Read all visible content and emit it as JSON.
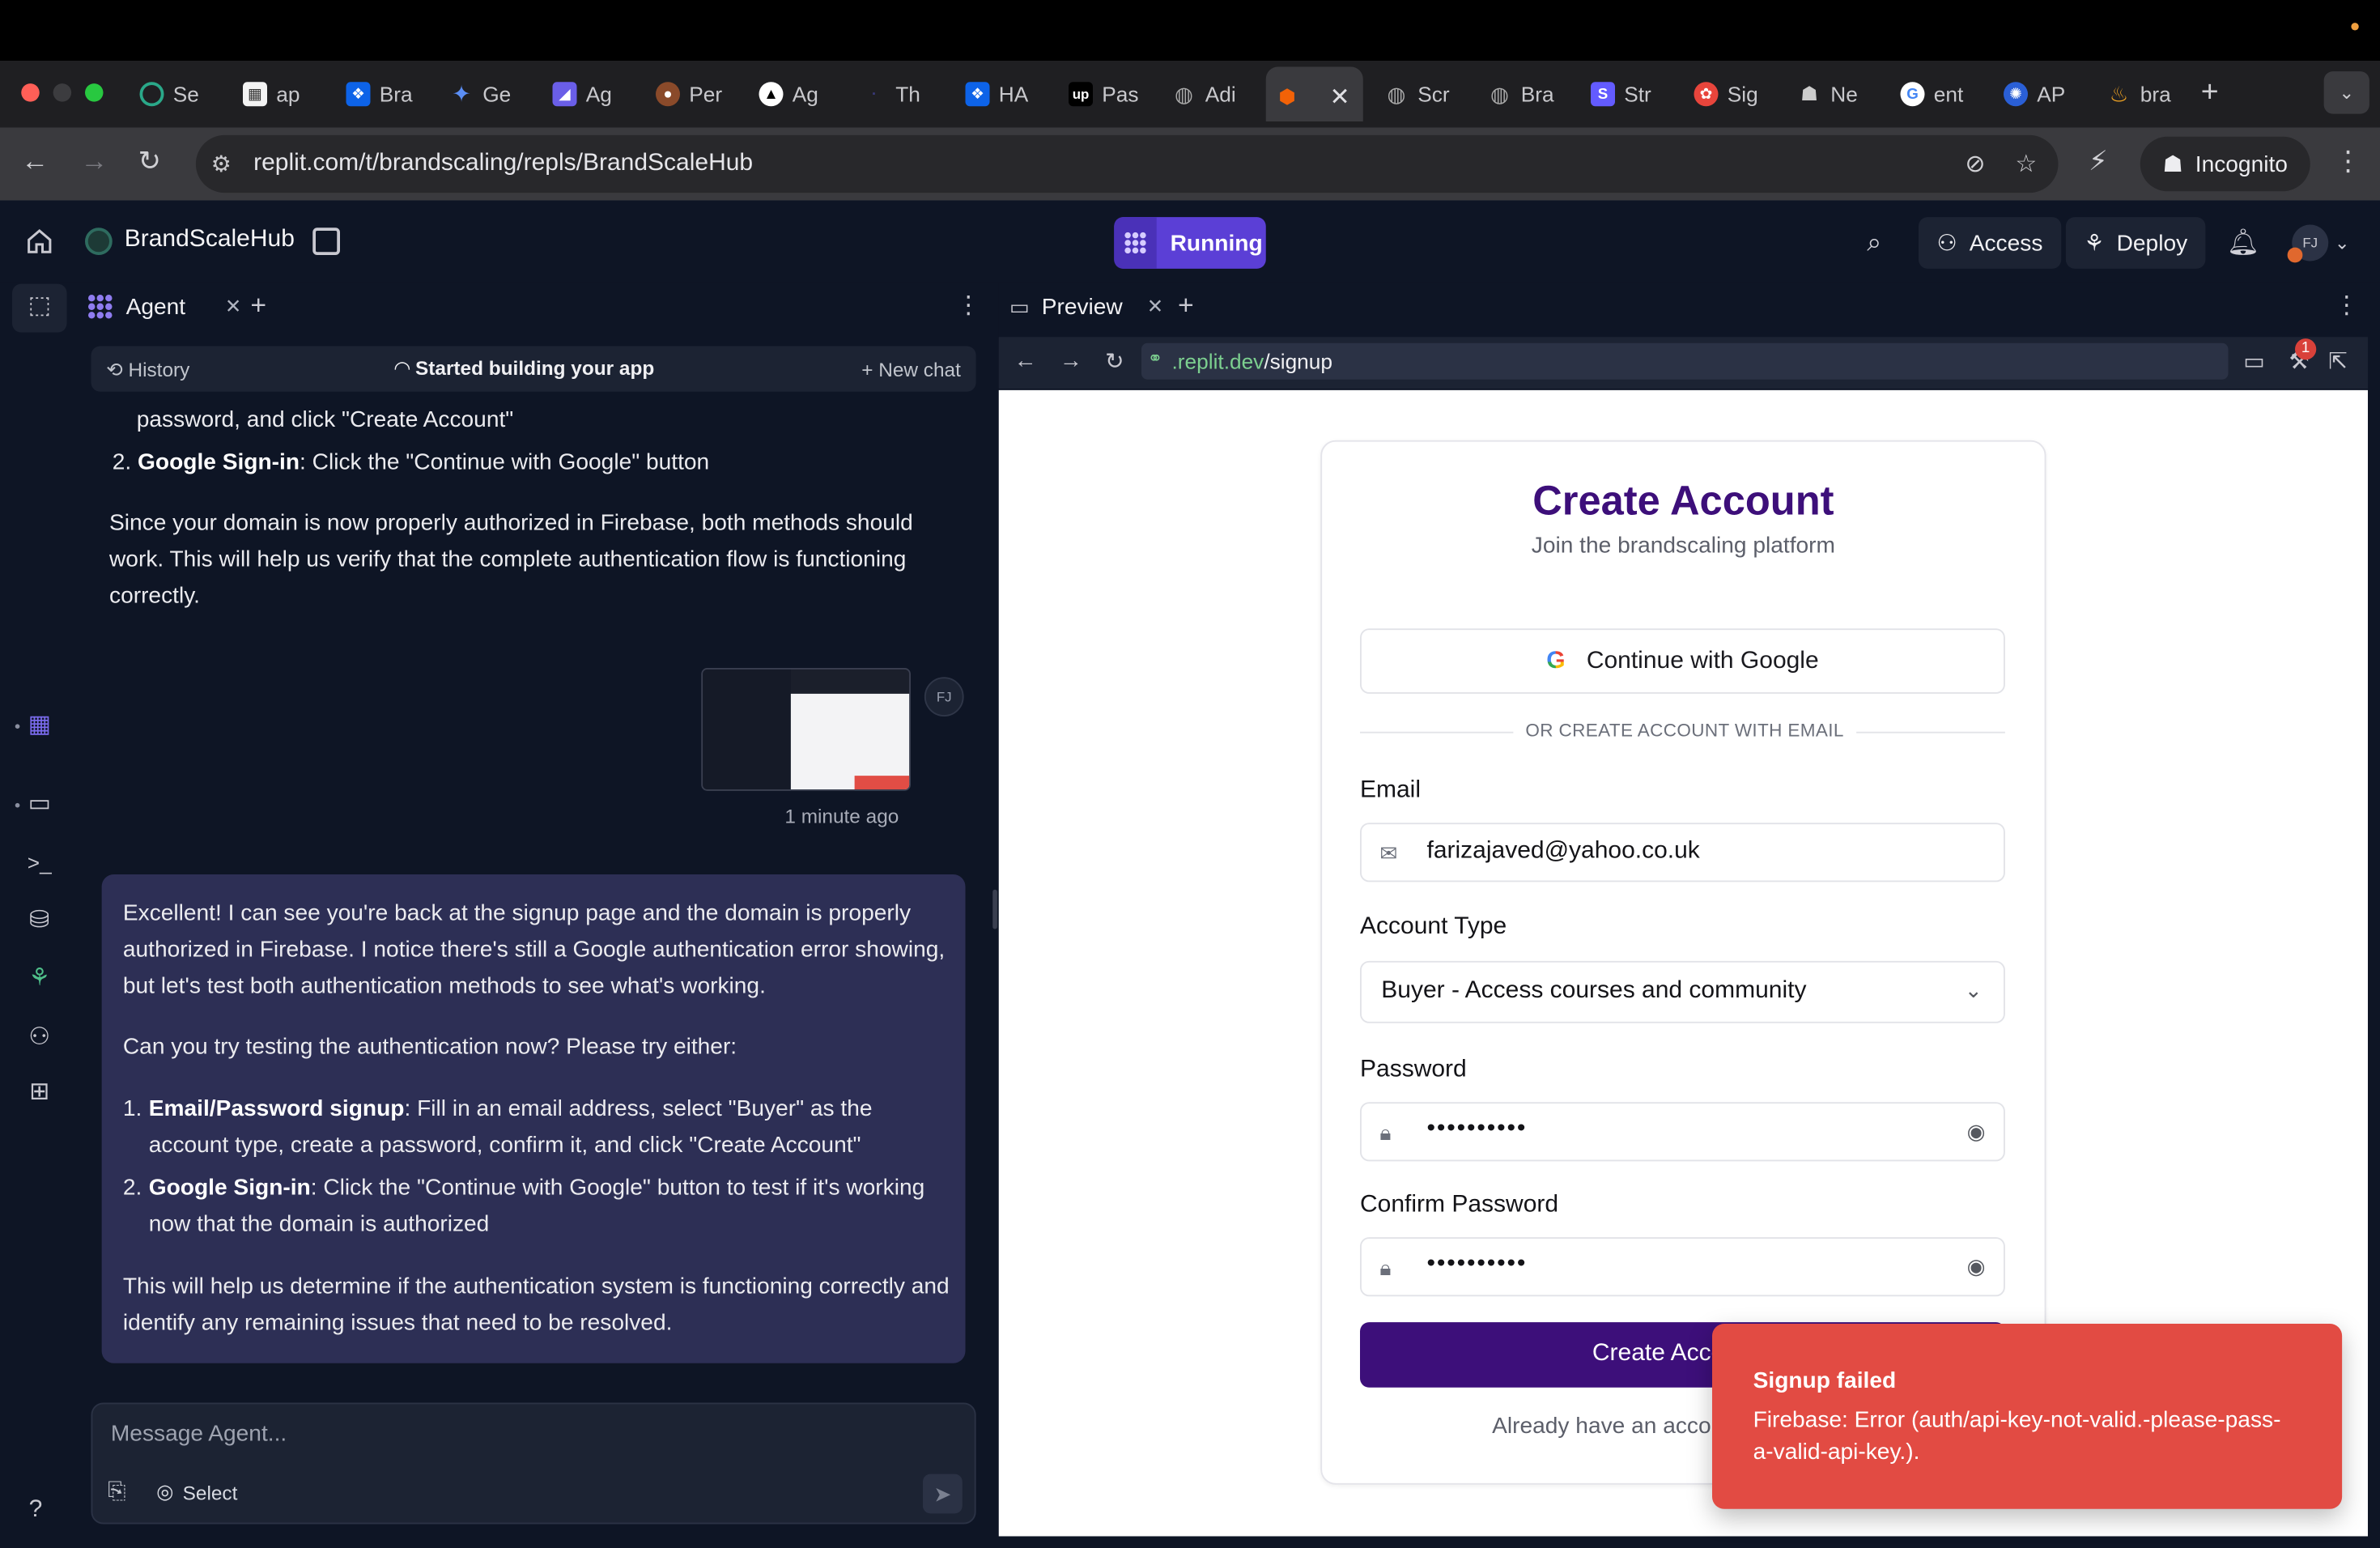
{
  "browser": {
    "tabs": [
      {
        "label": "Se",
        "icon": "openai-icon"
      },
      {
        "label": "ap",
        "icon": "app-icon"
      },
      {
        "label": "Bra",
        "icon": "dropbox-icon"
      },
      {
        "label": "Ge",
        "icon": "gemini-icon"
      },
      {
        "label": "Ag",
        "icon": "agent-icon"
      },
      {
        "label": "Per",
        "icon": "perplexity-icon"
      },
      {
        "label": "Ag",
        "icon": "triangle-icon"
      },
      {
        "label": "Th",
        "icon": "dot-icon"
      },
      {
        "label": "HA",
        "icon": "dropbox-icon"
      },
      {
        "label": "Pas",
        "icon": "upwork-icon"
      },
      {
        "label": "Adi",
        "icon": "globe-icon"
      },
      {
        "label": "",
        "icon": "replit-icon"
      },
      {
        "label": "Scr",
        "icon": "globe-icon"
      },
      {
        "label": "Bra",
        "icon": "globe-icon"
      },
      {
        "label": "Str",
        "icon": "stripe-icon"
      },
      {
        "label": "Sig",
        "icon": "sig-icon"
      },
      {
        "label": "Ne",
        "icon": "incognito-icon"
      },
      {
        "label": "ent",
        "icon": "google-icon"
      },
      {
        "label": "AP",
        "icon": "openai-icon"
      },
      {
        "label": "bra",
        "icon": "firebase-icon"
      }
    ],
    "url": "replit.com/t/brandscaling/repls/BrandScaleHub",
    "incognito_label": "Incognito"
  },
  "replit": {
    "project_name": "BrandScaleHub",
    "running_label": "Running",
    "access_label": "Access",
    "deploy_label": "Deploy",
    "avatar_initials": "FJ"
  },
  "agent": {
    "tab_label": "Agent",
    "history_label": "History",
    "status_label": "Started building your app",
    "new_chat_label": "New chat",
    "prev_msg": {
      "line1": "password, and click \"Create Account\"",
      "item2_bold": "Google Sign-in",
      "item2_rest": ": Click the \"Continue with Google\" button",
      "para": "Since your domain is now properly authorized in Firebase, both methods should work. This will help us verify that the complete authentication flow is functioning correctly."
    },
    "user_initials": "FJ",
    "timestamp": "1 minute ago",
    "reply": {
      "p1": "Excellent! I can see you're back at the signup page and the domain is properly authorized in Firebase. I notice there's still a Google authentication error showing, but let's test both authentication methods to see what's working.",
      "p2": "Can you try testing the authentication now? Please try either:",
      "item1_bold": "Email/Password signup",
      "item1_rest": ": Fill in an email address, select \"Buyer\" as the account type, create a password, confirm it, and click \"Create Account\"",
      "item2_bold": "Google Sign-in",
      "item2_rest": ": Click the \"Continue with Google\" button to test if it's working now that the domain is authorized",
      "p3": "This will help us determine if the authentication system is functioning correctly and identify any remaining issues that need to be resolved."
    },
    "composer_placeholder": "Message Agent...",
    "select_label": "Select"
  },
  "preview": {
    "tab_label": "Preview",
    "url_domain": ".replit.dev",
    "url_path": "/signup",
    "badge_count": "1"
  },
  "signup": {
    "title": "Create Account",
    "subtitle": "Join the brandscaling platform",
    "google_label": "Continue with Google",
    "divider_label": "OR CREATE ACCOUNT WITH EMAIL",
    "email_label": "Email",
    "email_value": "farizajaved@yahoo.co.uk",
    "account_type_label": "Account Type",
    "account_type_value": "Buyer - Access courses and community",
    "password_label": "Password",
    "password_value": "••••••••••",
    "confirm_label": "Confirm Password",
    "confirm_value": "••••••••••",
    "submit_label": "Create Account",
    "login_prompt": "Already have an account?"
  },
  "toast": {
    "title": "Signup failed",
    "body": "Firebase: Error (auth/api-key-not-valid.-please-pass-a-valid-api-key.)."
  },
  "colors": {
    "brand_purple": "#3d0f7a",
    "running_purple": "#5b3fd6",
    "toast_red": "#e24b43",
    "agent_bubble": "#2d2f55",
    "replit_bg": "#0e1525"
  }
}
